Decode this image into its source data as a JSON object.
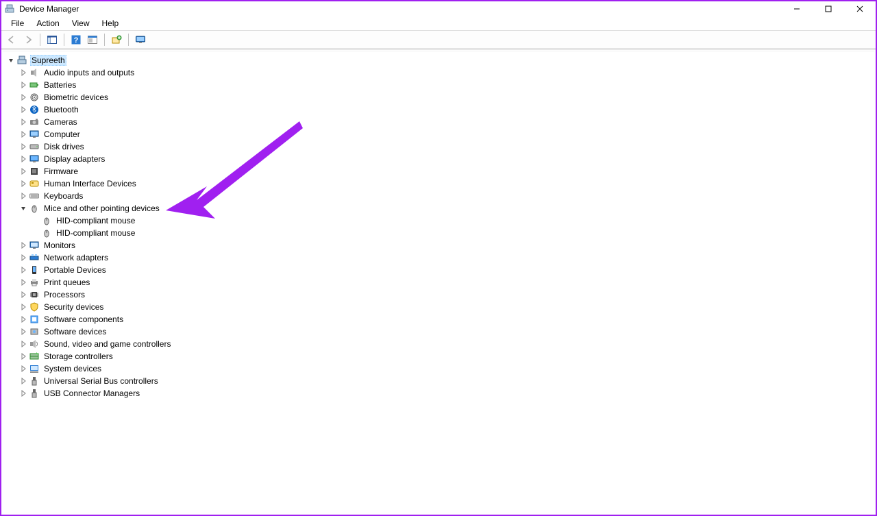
{
  "title": "Device Manager",
  "menu": {
    "file": "File",
    "action": "Action",
    "view": "View",
    "help": "Help"
  },
  "root": {
    "name": "Supreeth"
  },
  "devices": [
    {
      "label": "Audio inputs and outputs",
      "icon": "audio"
    },
    {
      "label": "Batteries",
      "icon": "battery"
    },
    {
      "label": "Biometric devices",
      "icon": "biometric"
    },
    {
      "label": "Bluetooth",
      "icon": "bluetooth"
    },
    {
      "label": "Cameras",
      "icon": "camera"
    },
    {
      "label": "Computer",
      "icon": "computer"
    },
    {
      "label": "Disk drives",
      "icon": "disk"
    },
    {
      "label": "Display adapters",
      "icon": "display"
    },
    {
      "label": "Firmware",
      "icon": "firmware"
    },
    {
      "label": "Human Interface Devices",
      "icon": "hid"
    },
    {
      "label": "Keyboards",
      "icon": "keyboard"
    },
    {
      "label": "Mice and other pointing devices",
      "icon": "mouse",
      "expanded": true,
      "children": [
        {
          "label": "HID-compliant mouse",
          "icon": "mouse"
        },
        {
          "label": "HID-compliant mouse",
          "icon": "mouse"
        }
      ]
    },
    {
      "label": "Monitors",
      "icon": "monitor"
    },
    {
      "label": "Network adapters",
      "icon": "network"
    },
    {
      "label": "Portable Devices",
      "icon": "portable"
    },
    {
      "label": "Print queues",
      "icon": "printer"
    },
    {
      "label": "Processors",
      "icon": "cpu"
    },
    {
      "label": "Security devices",
      "icon": "security"
    },
    {
      "label": "Software components",
      "icon": "softcomp"
    },
    {
      "label": "Software devices",
      "icon": "softdev"
    },
    {
      "label": "Sound, video and game controllers",
      "icon": "sound"
    },
    {
      "label": "Storage controllers",
      "icon": "storage"
    },
    {
      "label": "System devices",
      "icon": "system"
    },
    {
      "label": "Universal Serial Bus controllers",
      "icon": "usb"
    },
    {
      "label": "USB Connector Managers",
      "icon": "usbconn"
    }
  ]
}
